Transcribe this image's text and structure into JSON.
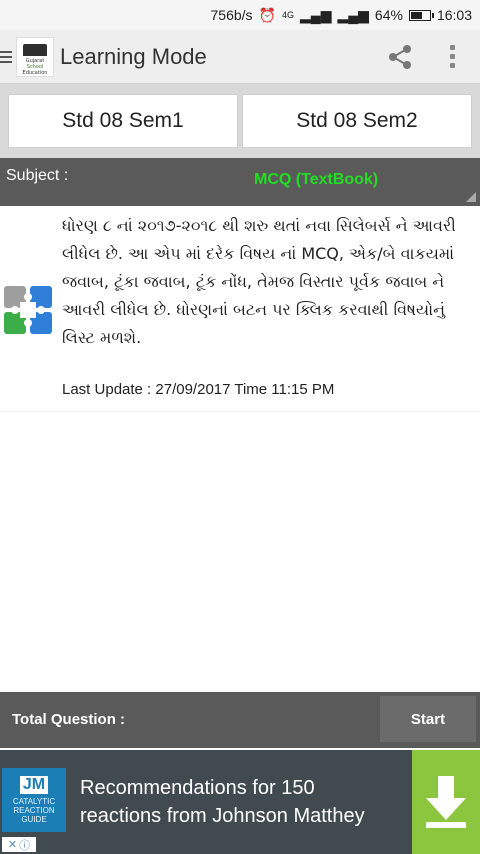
{
  "status_bar": {
    "speed": "756b/s",
    "network": "4G",
    "battery": "64%",
    "battery_level": 0.64,
    "time": "16:03"
  },
  "toolbar": {
    "title": "Learning Mode",
    "logo_lines": [
      "Gujarat",
      "School",
      "Education"
    ],
    "icons": [
      "menu-icon",
      "share-icon",
      "overflow-menu-icon"
    ]
  },
  "tabs": [
    {
      "label": "Std 08 Sem1"
    },
    {
      "label": "Std 08 Sem2"
    }
  ],
  "subject": {
    "label": "Subject :",
    "selected": "MCQ  (TextBook)",
    "selected_color": "#22dd22"
  },
  "item": {
    "icon": "puzzle-icon",
    "description": "ધોરણ ૮ નાં ૨૦૧૭-૨૦૧૮ થી શરુ થતાં નવા સિલેબર્સ ને આવરી લીધેલ છે. આ એપ માં દરેક વિષય નાં MCQ, એક/બે વાકયમાં જવાબ, ટૂંકા જવાબ, ટૂંક નોંધ, તેમજ વિસ્તાર પૂર્વક જવાબ ને આવરી લીધેલ છે. ધોરણનાં બટન પર ક્લિક કરવાથી વિષયોનું લિસ્ટ મળશે.",
    "last_update": "Last Update : 27/09/2017 Time   11:15 PM"
  },
  "footer": {
    "total_label": "Total Question :",
    "start_label": "Start"
  },
  "ad": {
    "logo_text": "JM",
    "logo_sub": [
      "CATALYTIC",
      "REACTION",
      "GUIDE"
    ],
    "text": "Recommendations for 150 reactions from Johnson Matthey",
    "download_icon": "download-icon",
    "accent": "#8cc63f"
  }
}
